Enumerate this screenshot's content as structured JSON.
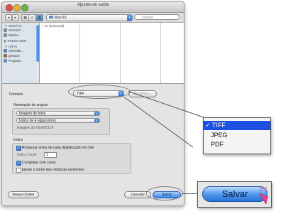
{
  "window": {
    "title": "Ajustes de saída",
    "toolbar": {
      "back": "◂",
      "forward": "▸",
      "location": "MacOS",
      "search_placeholder": "suchen"
    },
    "sidebar": {
      "sections": [
        {
          "header": "▼ GERÄTE",
          "items": [
            "Gerhard ...",
            "Macbo..."
          ]
        },
        {
          "header": "▶ FREIGABEN",
          "items": []
        },
        {
          "header": "▼ ORTE",
          "items": [
            "Schreibti...",
            "gerhard",
            "Program..."
          ]
        }
      ]
    },
    "column1_item": "Sr (Universal)",
    "format": {
      "label": "Formato:",
      "value": "TIFF",
      "options_button": "Opciones..."
    },
    "naming": {
      "label": "Nomeação de arquivo",
      "prefix_value": "Imagem de fotos",
      "index_value": "Índice de 4 algarismos)",
      "example": "Imagem do foto0001.tif"
    },
    "index": {
      "label": "Índice",
      "reset_label": "Restaurar antes de cada digitalização em lote",
      "start_label": "Índice inicial:",
      "start_value": "1",
      "fill_zeros_label": "Completar com zeros",
      "ignore_label": "Ignore o nome das molduras existentes"
    },
    "buttons": {
      "new_folder": "Nueva Ordner",
      "cancel": "Cancelar",
      "save": "Salvar"
    }
  },
  "callout_menu": {
    "checkmark": "✓",
    "options": [
      "TIFF",
      "JPEG",
      "PDF"
    ],
    "selected": "TIFF"
  },
  "callout_save": {
    "label": "Salvar"
  }
}
